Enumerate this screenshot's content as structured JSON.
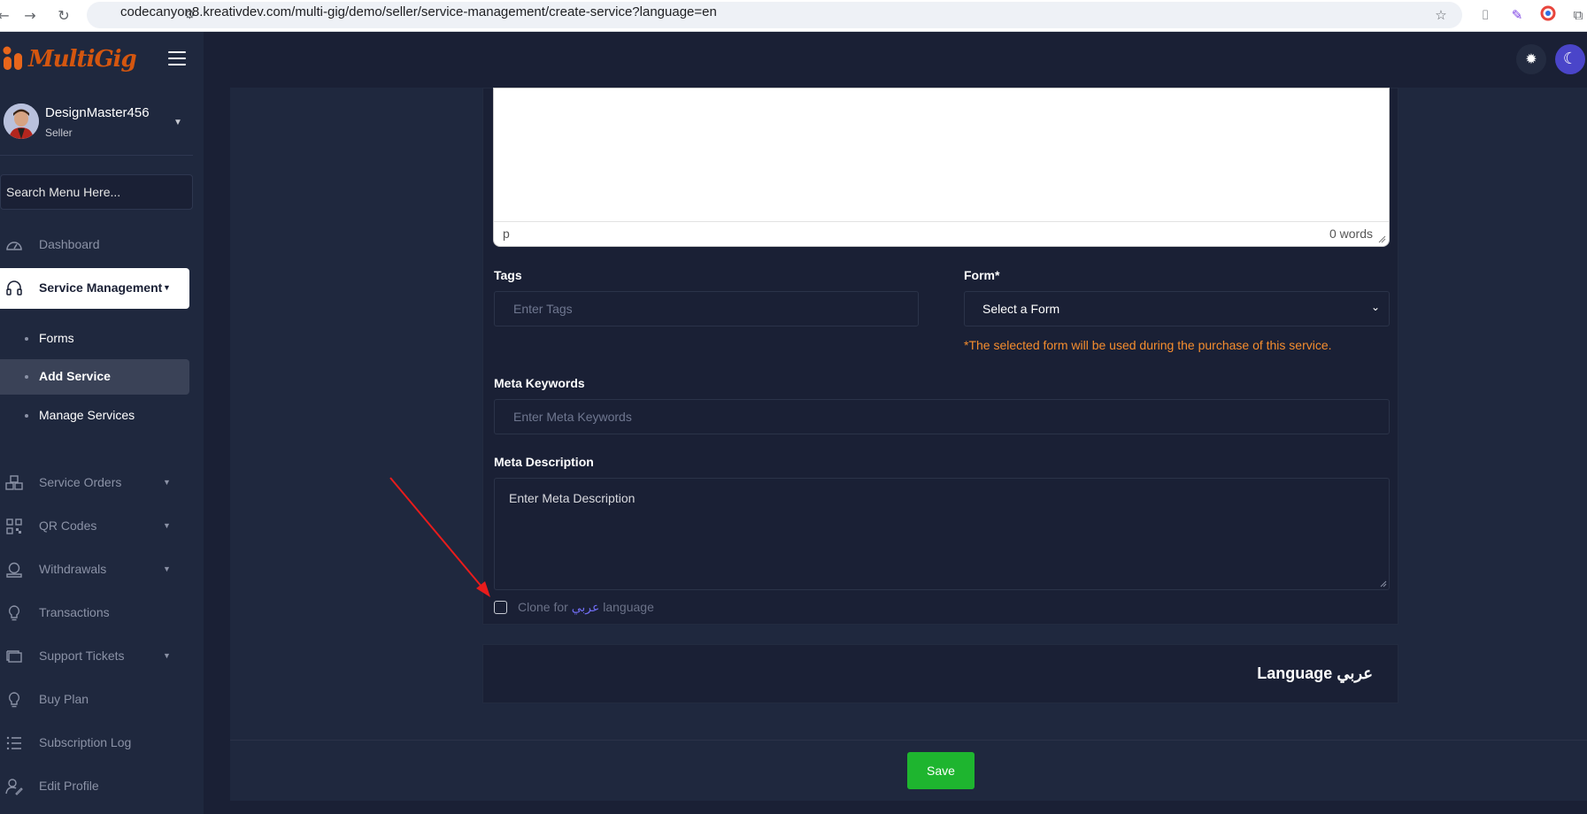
{
  "browser": {
    "url": "codecanyon8.kreativdev.com/multi-gig/demo/seller/service-management/create-service?language=en"
  },
  "brand": {
    "logo_text": "MultiGig",
    "accent": "#d4560f"
  },
  "user": {
    "name": "DesignMaster456",
    "role": "Seller"
  },
  "sidebar": {
    "search_placeholder": "Search Menu Here...",
    "items": [
      {
        "label": "Dashboard",
        "icon": "dashboard-icon"
      },
      {
        "label": "Service Management",
        "icon": "headset-icon",
        "active": true
      },
      {
        "label": "Service Orders",
        "icon": "boxes-icon"
      },
      {
        "label": "QR Codes",
        "icon": "qr-icon"
      },
      {
        "label": "Withdrawals",
        "icon": "withdraw-icon"
      },
      {
        "label": "Transactions",
        "icon": "bulb-icon"
      },
      {
        "label": "Support Tickets",
        "icon": "tickets-icon"
      },
      {
        "label": "Buy Plan",
        "icon": "bulb-icon"
      },
      {
        "label": "Subscription Log",
        "icon": "list-icon"
      },
      {
        "label": "Edit Profile",
        "icon": "user-edit-icon"
      }
    ],
    "sub_items": [
      {
        "label": "Forms"
      },
      {
        "label": "Add Service",
        "current": true
      },
      {
        "label": "Manage Services"
      }
    ]
  },
  "editor": {
    "status_tag": "p",
    "word_count": "0 words"
  },
  "form": {
    "tags_label": "Tags",
    "tags_placeholder": "Enter Tags",
    "form_label": "Form*",
    "form_selected": "Select a Form",
    "form_note": "*The selected form will be used during the purchase of this service.",
    "meta_keywords_label": "Meta Keywords",
    "meta_keywords_placeholder": "Enter Meta Keywords",
    "meta_description_label": "Meta Description",
    "meta_description_placeholder": "Enter Meta Description",
    "clone_prefix": "Clone for",
    "clone_language": "عربي",
    "clone_suffix": "language",
    "clone_checked": false
  },
  "language_section": {
    "title": "Language عربي"
  },
  "actions": {
    "save_label": "Save",
    "save_color": "#1eb52f"
  }
}
